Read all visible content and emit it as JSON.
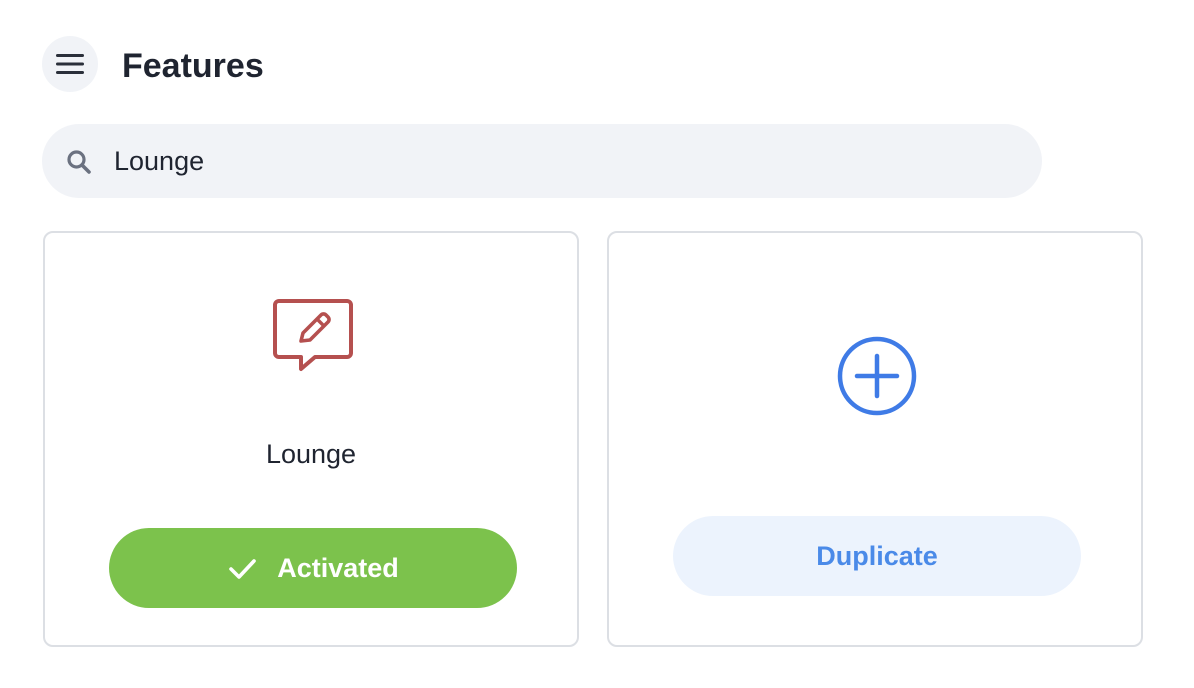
{
  "header": {
    "title": "Features",
    "menu_icon": "hamburger-menu-icon"
  },
  "search": {
    "value": "Lounge",
    "icon": "search-icon"
  },
  "cards": [
    {
      "label": "Lounge",
      "icon": "edit-chat-icon",
      "icon_color": "#b5504f",
      "button_label": "Activated",
      "button_icon": "check-icon",
      "button_color": "#7cc24c"
    },
    {
      "icon": "plus-circle-icon",
      "icon_color": "#3f7be6",
      "button_label": "Duplicate",
      "button_color": "#ecf3fd",
      "button_text_color": "#4a8ae8"
    }
  ]
}
